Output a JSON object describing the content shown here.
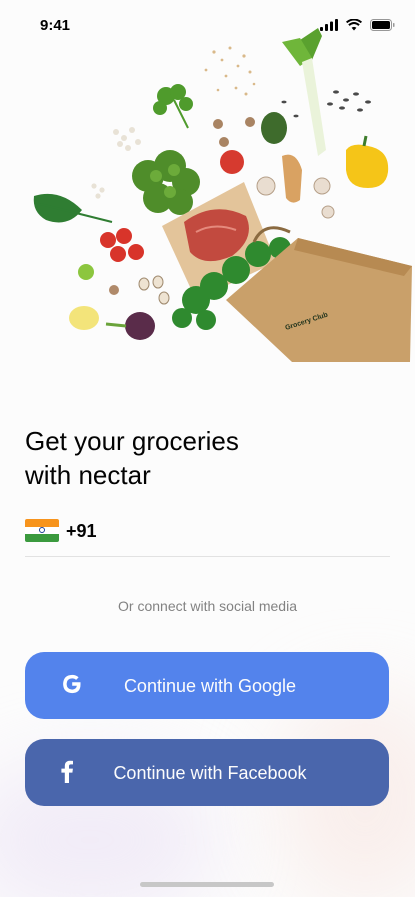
{
  "status_bar": {
    "time": "9:41"
  },
  "hero": {
    "bag_brand": "Grocery Club"
  },
  "headline": {
    "line1": "Get your groceries",
    "line2": "with nectar"
  },
  "phone": {
    "country_flag": "india-flag-icon",
    "dial_code": "+91",
    "value": ""
  },
  "social": {
    "caption": "Or connect with social media",
    "google_label": "Continue with Google",
    "facebook_label": "Continue with Facebook"
  },
  "colors": {
    "google_button": "#5383ec",
    "facebook_button": "#4a66ac",
    "text_primary": "#030303",
    "caption": "#828282"
  }
}
